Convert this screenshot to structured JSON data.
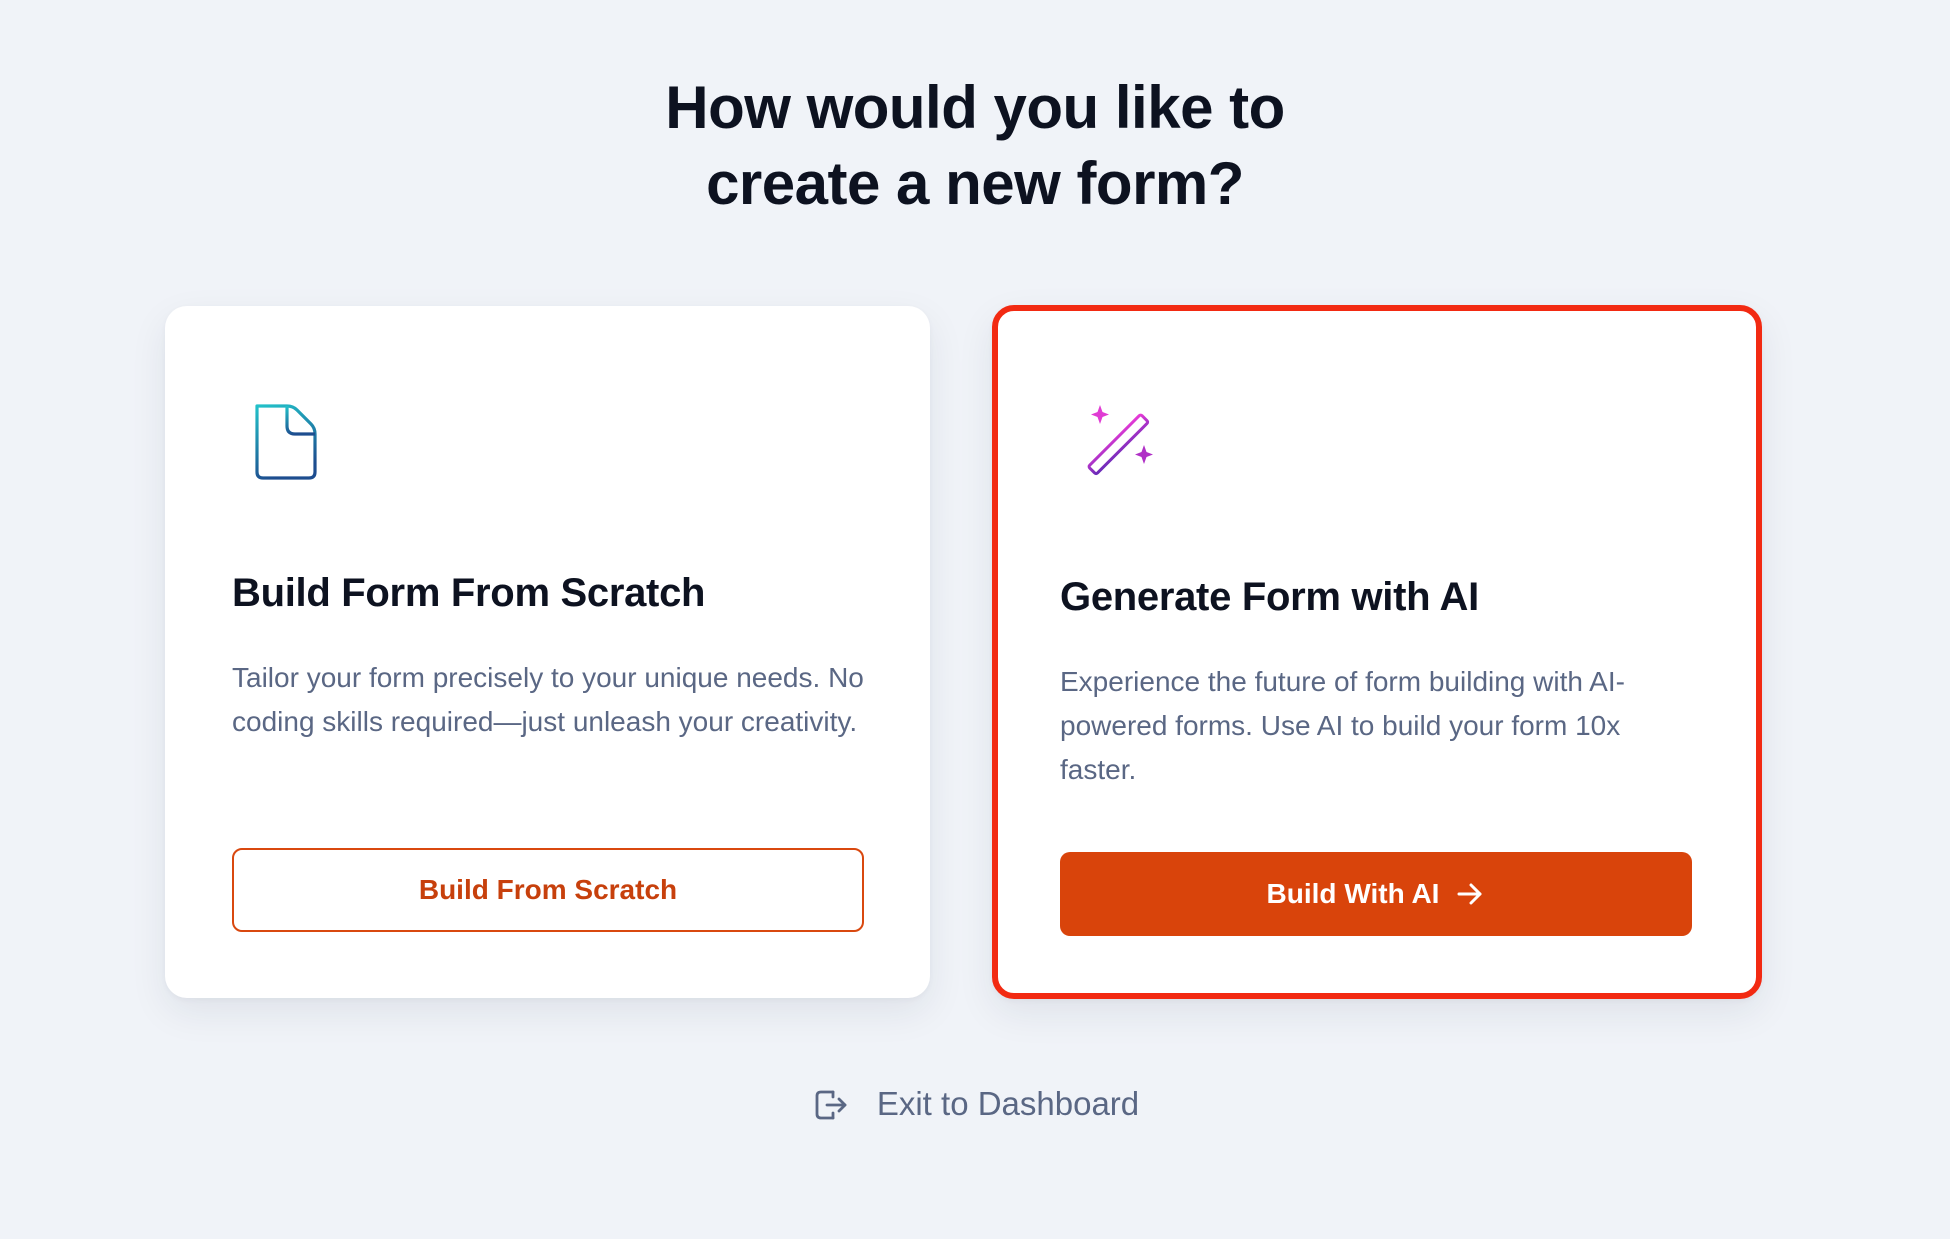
{
  "header": {
    "title_line1": "How would you like to",
    "title_line2": "create a new form?"
  },
  "cards": [
    {
      "icon": "file-plus-icon",
      "heading": "Build Form From Scratch",
      "description": "Tailor your form precisely to your unique needs. No coding skills required—just unleash your creativity.",
      "button_label": "Build From Scratch",
      "selected": false
    },
    {
      "icon": "magic-wand-icon",
      "heading": "Generate Form with AI",
      "description": "Experience the future of form building with AI-powered forms. Use AI to build your form 10x faster.",
      "button_label": "Build With AI",
      "button_icon": "arrow-right-icon",
      "selected": true
    }
  ],
  "footer": {
    "exit_icon": "logout-icon",
    "exit_label": "Exit to Dashboard"
  },
  "colors": {
    "background": "#f0f3f8",
    "accent": "#d9440b",
    "highlight_border": "#f22a12",
    "heading_text": "#0d1220",
    "body_text": "#5a6784"
  }
}
